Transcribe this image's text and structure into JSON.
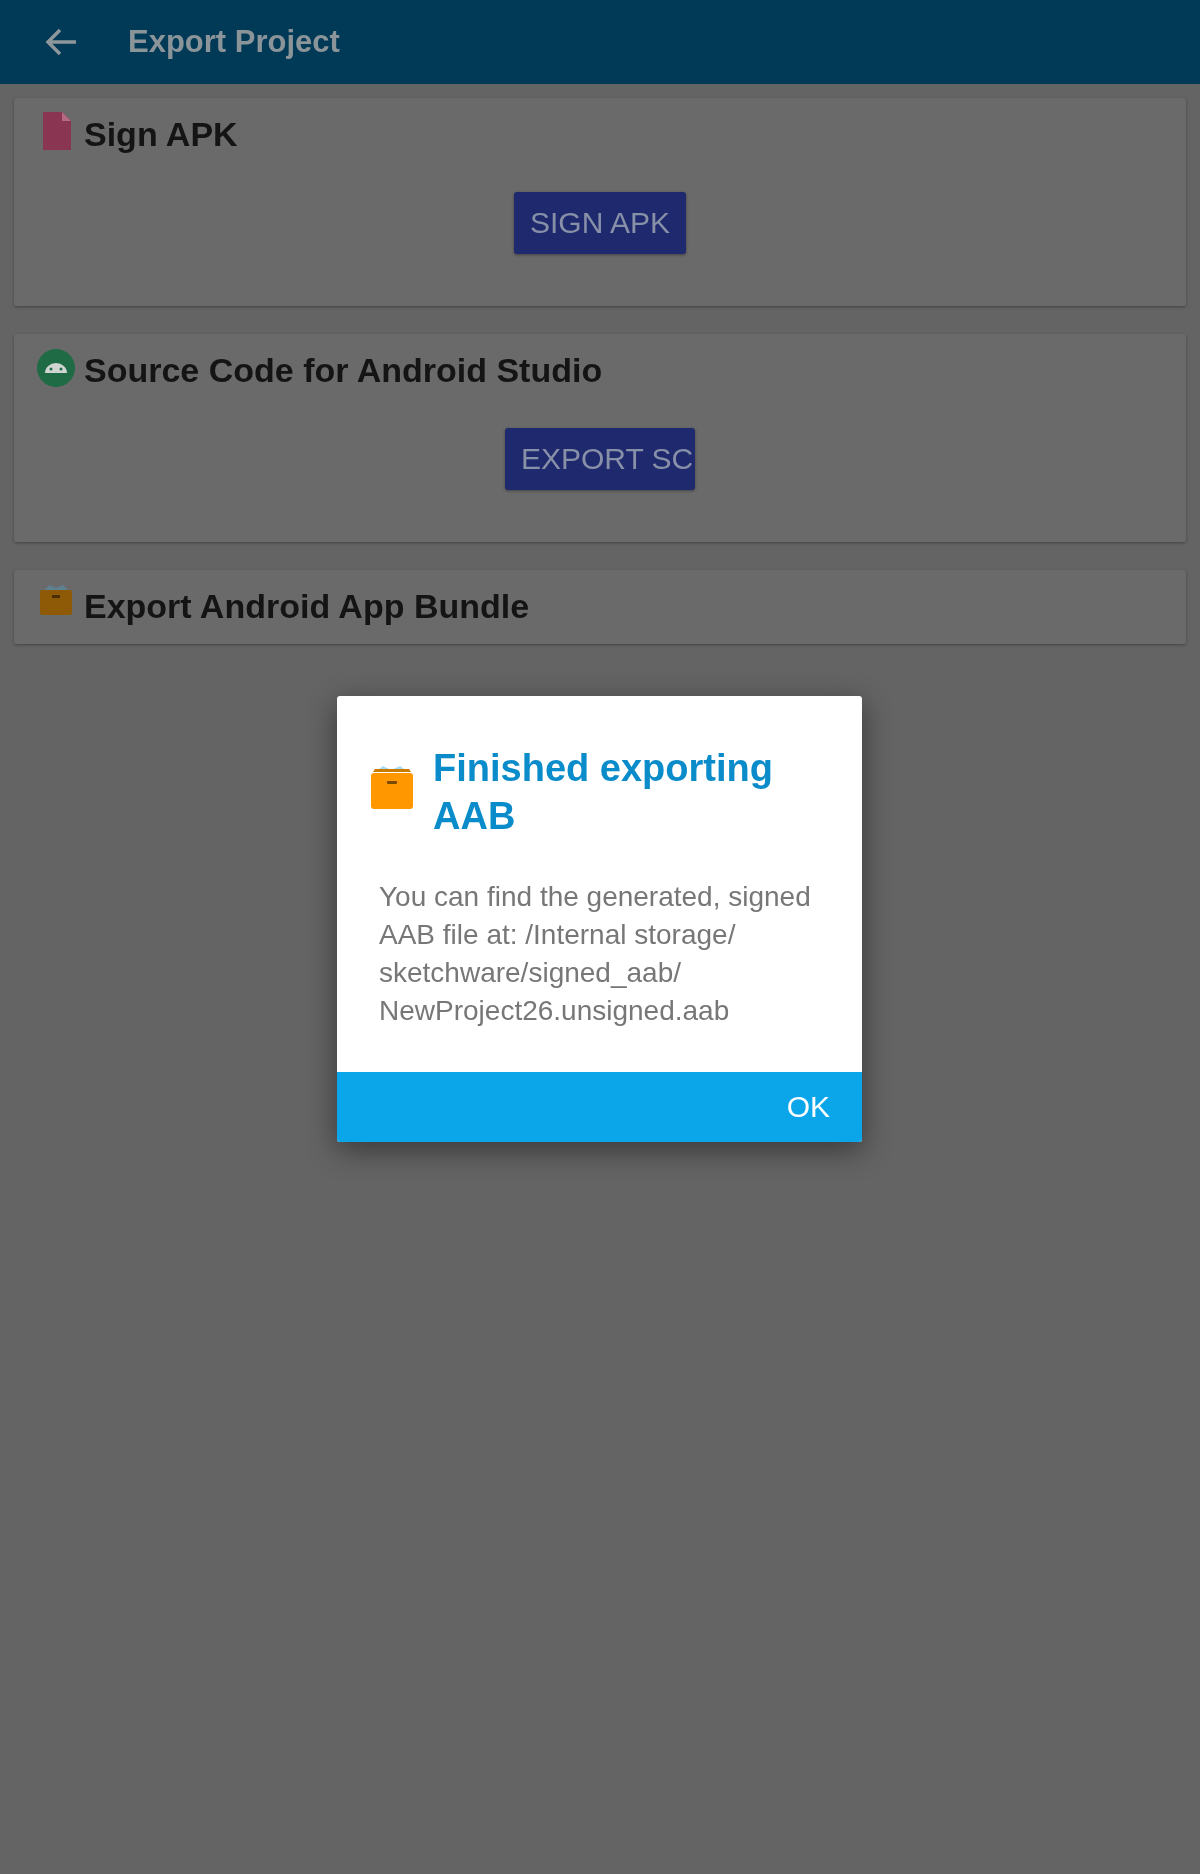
{
  "app_bar": {
    "title": "Export Project"
  },
  "cards": [
    {
      "kind": "apk",
      "title": "Sign APK",
      "button": "SIGN APK"
    },
    {
      "kind": "android",
      "title": "Source Code for Android Studio",
      "button": "EXPORT SC"
    },
    {
      "kind": "bundle",
      "title": "Export Android App Bundle"
    }
  ],
  "dialog": {
    "title": "Finished exporting AAB",
    "message": "You can find the generated, signed AAB file at: /Internal storage/sketchware/signed_aab/NewProject26.unsigned.aab",
    "buttons": [
      "OK"
    ]
  }
}
